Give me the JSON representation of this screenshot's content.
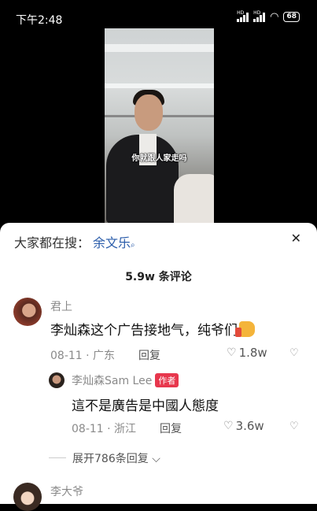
{
  "status": {
    "time": "下午2:48",
    "battery": "68",
    "net1": "HD",
    "net2": "HD"
  },
  "video": {
    "caption": "你就跟人家走吗"
  },
  "search": {
    "prefix": "大家都在搜：",
    "keyword": "余文乐",
    "icon": "search-icon"
  },
  "comments_count": "5.9w 条评论",
  "comments": [
    {
      "user": "君上",
      "text": "李灿森这个广告接地气，纯爷们",
      "date_loc": "08-11 · 广东",
      "reply_label": "回复",
      "likes": "1.8w"
    },
    {
      "user": "李灿森Sam Lee",
      "author_badge": "作者",
      "text": "這不是廣告是中國人態度",
      "date_loc": "08-11 · 浙江",
      "reply_label": "回复",
      "likes": "3.6w"
    }
  ],
  "expand_label": "展开786条回复",
  "next_user": "李大爷",
  "colors": {
    "accent": "#2a5caa",
    "author_badge": "#e7374d"
  }
}
